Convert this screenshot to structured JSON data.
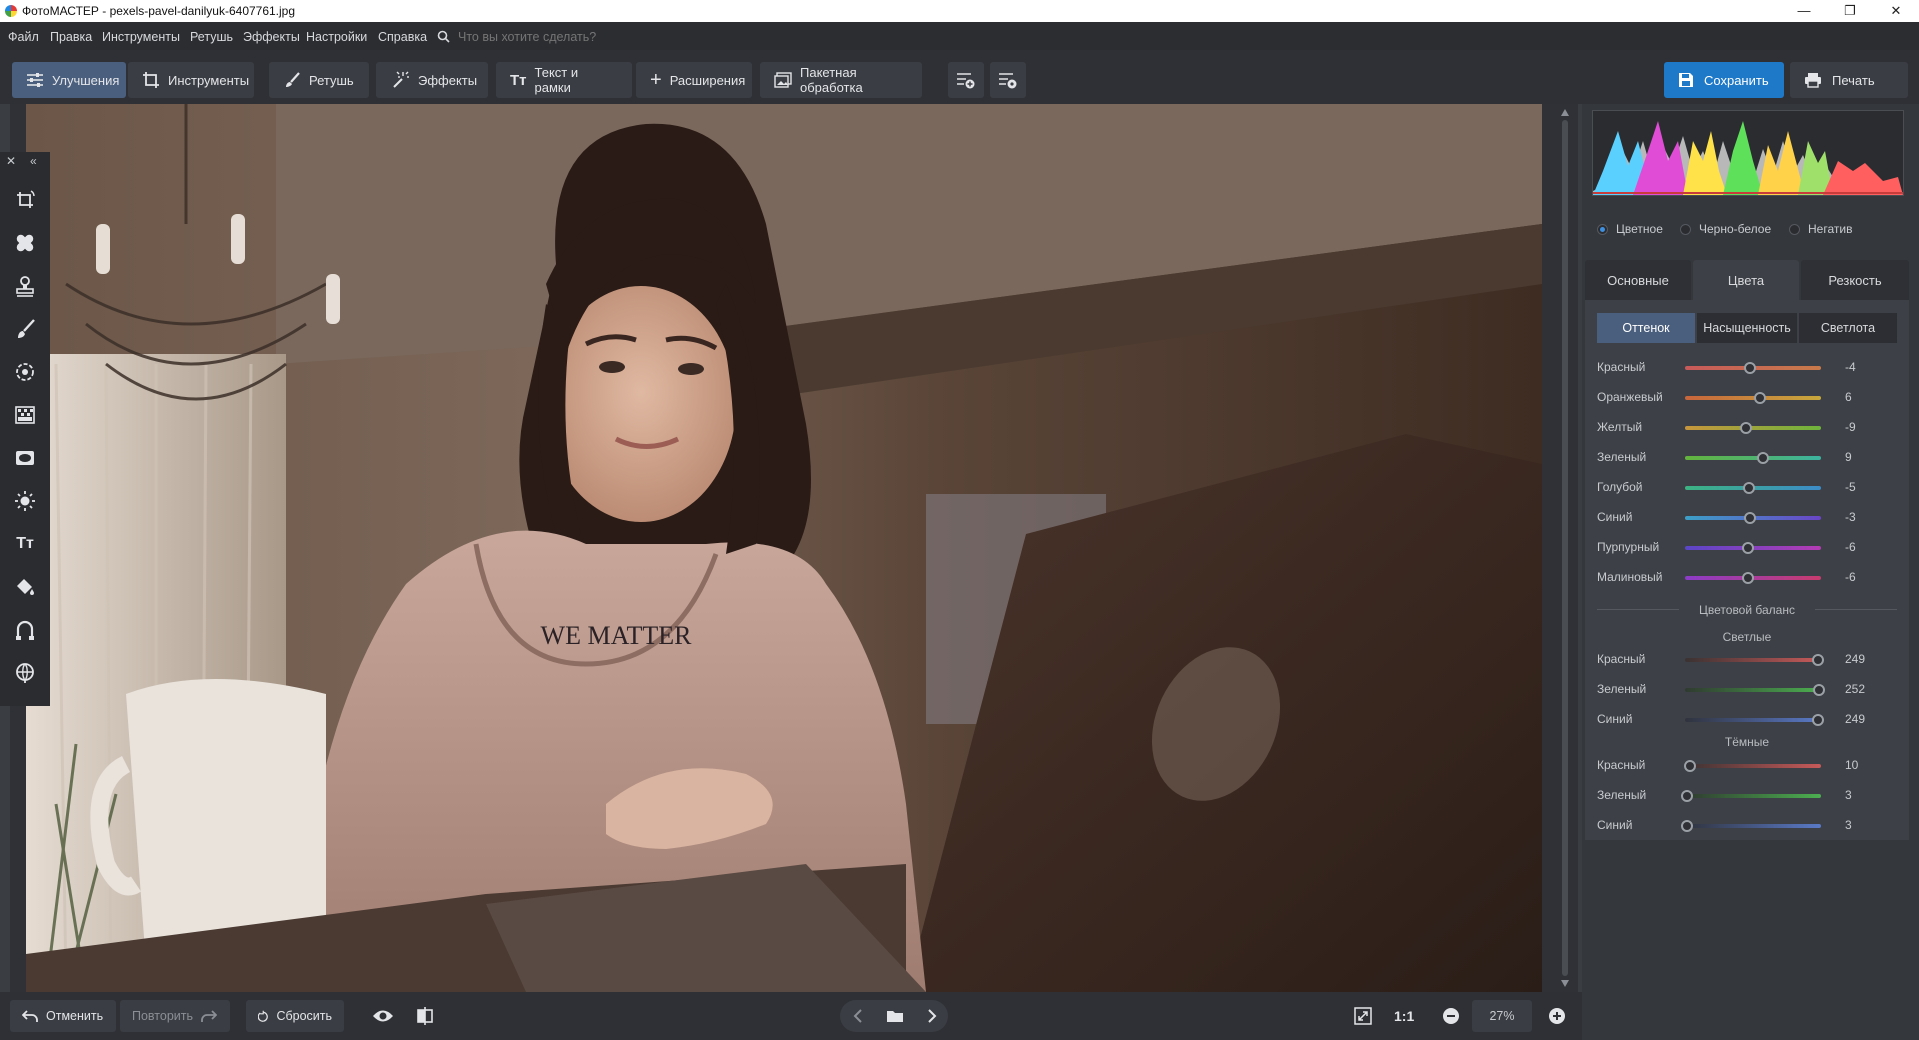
{
  "window": {
    "title": "ФотоМАСТЕР - pexels-pavel-danilyuk-6407761.jpg",
    "minimize": "—",
    "maximize": "❐",
    "close": "✕"
  },
  "menu": {
    "items": [
      "Файл",
      "Правка",
      "Инструменты",
      "Ретушь",
      "Эффекты",
      "Настройки",
      "Справка"
    ],
    "search_placeholder": "Что вы хотите сделать?"
  },
  "toolbar": {
    "tabs": [
      "Улучшения",
      "Инструменты",
      "Ретушь",
      "Эффекты",
      "Текст и рамки",
      "Расширения"
    ],
    "batch": "Пакетная обработка",
    "save": "Сохранить",
    "print": "Печать"
  },
  "photo": {
    "shirt_text": "WE MATTER"
  },
  "mode": {
    "options": [
      "Цветное",
      "Черно-белое",
      "Негатив"
    ],
    "selected": "Цветное"
  },
  "tabs": [
    "Основные",
    "Цвета",
    "Резкость"
  ],
  "active_tab": "Цвета",
  "subtabs": [
    "Оттенок",
    "Насыщенность",
    "Светлота"
  ],
  "active_subtab": "Оттенок",
  "hue_sliders": [
    {
      "label": "Красный",
      "value": "-4",
      "pos": 0.48,
      "colors": [
        "#c85a5a",
        "#c87a4a"
      ]
    },
    {
      "label": "Оранжевый",
      "value": "6",
      "pos": 0.55,
      "colors": [
        "#c8653c",
        "#c8a83c"
      ]
    },
    {
      "label": "Желтый",
      "value": "-9",
      "pos": 0.45,
      "colors": [
        "#c8963c",
        "#6eb43c"
      ]
    },
    {
      "label": "Зеленый",
      "value": "9",
      "pos": 0.57,
      "colors": [
        "#64b43c",
        "#3cb4a0"
      ]
    },
    {
      "label": "Голубой",
      "value": "-5",
      "pos": 0.47,
      "colors": [
        "#3cb482",
        "#3c8cc8"
      ]
    },
    {
      "label": "Синий",
      "value": "-3",
      "pos": 0.48,
      "colors": [
        "#3ca0c8",
        "#6a46c8"
      ]
    },
    {
      "label": "Пурпурный",
      "value": "-6",
      "pos": 0.46,
      "colors": [
        "#5a46c8",
        "#b43cb4"
      ]
    },
    {
      "label": "Малиновый",
      "value": "-6",
      "pos": 0.46,
      "colors": [
        "#8c3cc8",
        "#c83c6e"
      ]
    }
  ],
  "balance": {
    "title": "Цветовой баланс",
    "light_title": "Светлые",
    "light": [
      {
        "label": "Красный",
        "value": "249",
        "pos": 0.976,
        "colors": [
          "#3a3232",
          "#c85a5a"
        ]
      },
      {
        "label": "Зеленый",
        "value": "252",
        "pos": 0.988,
        "colors": [
          "#2f3a30",
          "#4caf50"
        ]
      },
      {
        "label": "Синий",
        "value": "249",
        "pos": 0.976,
        "colors": [
          "#30333d",
          "#5a7ac8"
        ]
      }
    ],
    "dark_title": "Тёмные",
    "dark": [
      {
        "label": "Красный",
        "value": "10",
        "pos": 0.039,
        "colors": [
          "#3a3232",
          "#c85a5a"
        ]
      },
      {
        "label": "Зеленый",
        "value": "3",
        "pos": 0.012,
        "colors": [
          "#2f3a30",
          "#4caf50"
        ]
      },
      {
        "label": "Синий",
        "value": "3",
        "pos": 0.012,
        "colors": [
          "#30333d",
          "#5a7ac8"
        ]
      }
    ]
  },
  "bottom": {
    "undo": "Отменить",
    "redo": "Повторить",
    "reset": "Сбросить",
    "zoom_1to1": "1:1",
    "zoom": "27%"
  }
}
